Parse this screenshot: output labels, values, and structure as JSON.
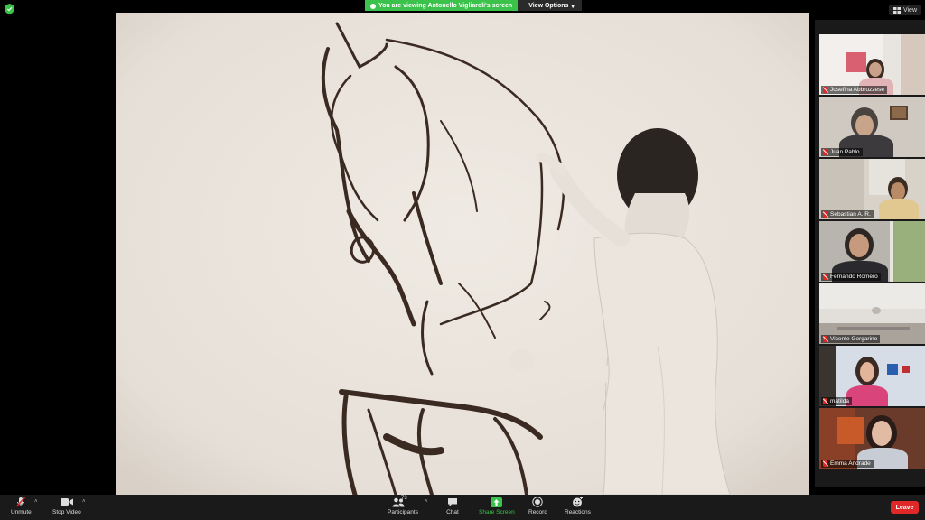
{
  "share_banner": {
    "viewing_text": "You are viewing Antonello Vigliaroli's screen",
    "view_options_label": "View Options"
  },
  "top_right": {
    "view_label": "View"
  },
  "gallery": {
    "participants": [
      {
        "name": "Josefina Abbruzzese"
      },
      {
        "name": "Juan Pablo"
      },
      {
        "name": "Sebastian A. R."
      },
      {
        "name": "Fernando Romero"
      },
      {
        "name": "Vicente Gorgarino"
      },
      {
        "name": "matilda"
      },
      {
        "name": "Emma Andrade"
      }
    ]
  },
  "toolbar": {
    "unmute_label": "Unmute",
    "stop_video_label": "Stop Video",
    "participants_label": "Participants",
    "participants_count": "73",
    "chat_label": "Chat",
    "share_screen_label": "Share Screen",
    "record_label": "Record",
    "reactions_label": "Reactions",
    "leave_label": "Leave"
  },
  "colors": {
    "accent_green": "#3ac24a",
    "leave_red": "#e02828",
    "toolbar_bg": "#1a1a1a"
  },
  "icons": {
    "security": "shield-icon",
    "view": "grid-icon",
    "mic": "mic-muted-icon",
    "video": "video-camera-icon",
    "participants": "people-icon",
    "chat": "chat-bubble-icon",
    "share": "share-screen-icon",
    "record": "record-icon",
    "reactions": "emoji-plus-icon"
  }
}
